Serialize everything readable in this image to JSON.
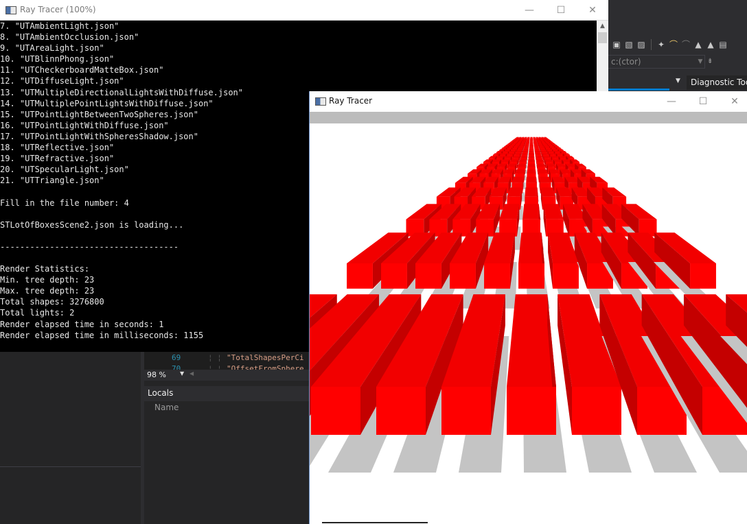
{
  "console_window": {
    "title": "Ray Tracer (100%)",
    "controls": {
      "minimize": "—",
      "maximize": "☐",
      "close": "✕"
    },
    "lines": [
      "7. \"UTAmbientLight.json\"",
      "8. \"UTAmbientOcclusion.json\"",
      "9. \"UTAreaLight.json\"",
      "10. \"UTBlinnPhong.json\"",
      "11. \"UTCheckerboardMatteBox.json\"",
      "12. \"UTDiffuseLight.json\"",
      "13. \"UTMultipleDirectionalLightsWithDiffuse.json\"",
      "14. \"UTMultiplePointLightsWithDiffuse.json\"",
      "15. \"UTPointLightBetweenTwoSpheres.json\"",
      "16. \"UTPointLightWithDiffuse.json\"",
      "17. \"UTPointLightWithSpheresShadow.json\"",
      "18. \"UTReflective.json\"",
      "19. \"UTRefractive.json\"",
      "20. \"UTSpecularLight.json\"",
      "21. \"UTTriangle.json\"",
      "",
      "Fill in the file number: 4",
      "",
      "STLotOfBoxesScene2.json is loading...",
      "",
      "------------------------------------",
      "",
      "Render Statistics:",
      "Min. tree depth: 23",
      "Max. tree depth: 23",
      "Total shapes: 3276800",
      "Total lights: 2",
      "Render elapsed time in seconds: 1",
      "Render elapsed time in milliseconds: 1155"
    ]
  },
  "render_window": {
    "title": "Ray Tracer",
    "controls": {
      "minimize": "—",
      "maximize": "☐",
      "close": "✕"
    },
    "scene": {
      "columns": 11,
      "rows": 26,
      "box_color": "#ff0000",
      "shadow_color": "#c4c4c4",
      "background": "#ffffff"
    }
  },
  "visual_studio": {
    "toolbar_icons": [
      "save-icon",
      "image-icon",
      "image-icon",
      "bookmark-icon",
      "undo-icon",
      "redo-icon",
      "lock-icon",
      "lock-icon",
      "file-icon"
    ],
    "member_dropdown": "c:(ctor)",
    "diagnostic_tools_label": "Diagnostic Tools",
    "editor": {
      "lines": [
        {
          "number": "69",
          "code": "\"TotalShapesPerCi"
        },
        {
          "number": "70",
          "code": "\"OffsetFromSphere"
        }
      ]
    },
    "zoom_level": "98 %",
    "locals_title": "Locals",
    "locals_name_column": "Name"
  }
}
